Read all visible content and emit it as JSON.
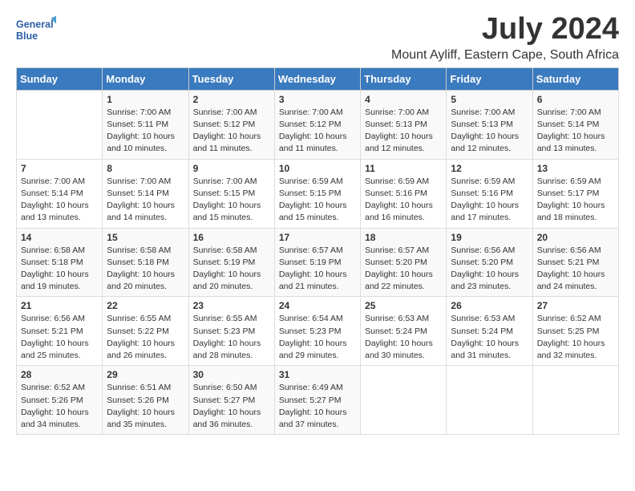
{
  "logo": {
    "line1": "General",
    "line2": "Blue"
  },
  "title": "July 2024",
  "location": "Mount Ayliff, Eastern Cape, South Africa",
  "header": {
    "days": [
      "Sunday",
      "Monday",
      "Tuesday",
      "Wednesday",
      "Thursday",
      "Friday",
      "Saturday"
    ]
  },
  "weeks": [
    [
      {
        "day": "",
        "info": ""
      },
      {
        "day": "1",
        "info": "Sunrise: 7:00 AM\nSunset: 5:11 PM\nDaylight: 10 hours\nand 10 minutes."
      },
      {
        "day": "2",
        "info": "Sunrise: 7:00 AM\nSunset: 5:12 PM\nDaylight: 10 hours\nand 11 minutes."
      },
      {
        "day": "3",
        "info": "Sunrise: 7:00 AM\nSunset: 5:12 PM\nDaylight: 10 hours\nand 11 minutes."
      },
      {
        "day": "4",
        "info": "Sunrise: 7:00 AM\nSunset: 5:13 PM\nDaylight: 10 hours\nand 12 minutes."
      },
      {
        "day": "5",
        "info": "Sunrise: 7:00 AM\nSunset: 5:13 PM\nDaylight: 10 hours\nand 12 minutes."
      },
      {
        "day": "6",
        "info": "Sunrise: 7:00 AM\nSunset: 5:14 PM\nDaylight: 10 hours\nand 13 minutes."
      }
    ],
    [
      {
        "day": "7",
        "info": ""
      },
      {
        "day": "8",
        "info": "Sunrise: 7:00 AM\nSunset: 5:14 PM\nDaylight: 10 hours\nand 14 minutes."
      },
      {
        "day": "9",
        "info": "Sunrise: 7:00 AM\nSunset: 5:15 PM\nDaylight: 10 hours\nand 15 minutes."
      },
      {
        "day": "10",
        "info": "Sunrise: 6:59 AM\nSunset: 5:15 PM\nDaylight: 10 hours\nand 15 minutes."
      },
      {
        "day": "11",
        "info": "Sunrise: 6:59 AM\nSunset: 5:16 PM\nDaylight: 10 hours\nand 16 minutes."
      },
      {
        "day": "12",
        "info": "Sunrise: 6:59 AM\nSunset: 5:16 PM\nDaylight: 10 hours\nand 17 minutes."
      },
      {
        "day": "13",
        "info": "Sunrise: 6:59 AM\nSunset: 5:17 PM\nDaylight: 10 hours\nand 18 minutes."
      }
    ],
    [
      {
        "day": "14",
        "info": "Sunrise: 6:58 AM\nSunset: 5:18 PM\nDaylight: 10 hours\nand 19 minutes."
      },
      {
        "day": "15",
        "info": "Sunrise: 6:58 AM\nSunset: 5:18 PM\nDaylight: 10 hours\nand 20 minutes."
      },
      {
        "day": "16",
        "info": "Sunrise: 6:58 AM\nSunset: 5:19 PM\nDaylight: 10 hours\nand 20 minutes."
      },
      {
        "day": "17",
        "info": "Sunrise: 6:57 AM\nSunset: 5:19 PM\nDaylight: 10 hours\nand 21 minutes."
      },
      {
        "day": "18",
        "info": "Sunrise: 6:57 AM\nSunset: 5:20 PM\nDaylight: 10 hours\nand 22 minutes."
      },
      {
        "day": "19",
        "info": "Sunrise: 6:56 AM\nSunset: 5:20 PM\nDaylight: 10 hours\nand 23 minutes."
      },
      {
        "day": "20",
        "info": "Sunrise: 6:56 AM\nSunset: 5:21 PM\nDaylight: 10 hours\nand 24 minutes."
      }
    ],
    [
      {
        "day": "21",
        "info": "Sunrise: 6:56 AM\nSunset: 5:21 PM\nDaylight: 10 hours\nand 25 minutes."
      },
      {
        "day": "22",
        "info": "Sunrise: 6:55 AM\nSunset: 5:22 PM\nDaylight: 10 hours\nand 26 minutes."
      },
      {
        "day": "23",
        "info": "Sunrise: 6:55 AM\nSunset: 5:23 PM\nDaylight: 10 hours\nand 28 minutes."
      },
      {
        "day": "24",
        "info": "Sunrise: 6:54 AM\nSunset: 5:23 PM\nDaylight: 10 hours\nand 29 minutes."
      },
      {
        "day": "25",
        "info": "Sunrise: 6:53 AM\nSunset: 5:24 PM\nDaylight: 10 hours\nand 30 minutes."
      },
      {
        "day": "26",
        "info": "Sunrise: 6:53 AM\nSunset: 5:24 PM\nDaylight: 10 hours\nand 31 minutes."
      },
      {
        "day": "27",
        "info": "Sunrise: 6:52 AM\nSunset: 5:25 PM\nDaylight: 10 hours\nand 32 minutes."
      }
    ],
    [
      {
        "day": "28",
        "info": "Sunrise: 6:52 AM\nSunset: 5:26 PM\nDaylight: 10 hours\nand 34 minutes."
      },
      {
        "day": "29",
        "info": "Sunrise: 6:51 AM\nSunset: 5:26 PM\nDaylight: 10 hours\nand 35 minutes."
      },
      {
        "day": "30",
        "info": "Sunrise: 6:50 AM\nSunset: 5:27 PM\nDaylight: 10 hours\nand 36 minutes."
      },
      {
        "day": "31",
        "info": "Sunrise: 6:49 AM\nSunset: 5:27 PM\nDaylight: 10 hours\nand 37 minutes."
      },
      {
        "day": "",
        "info": ""
      },
      {
        "day": "",
        "info": ""
      },
      {
        "day": "",
        "info": ""
      }
    ]
  ]
}
